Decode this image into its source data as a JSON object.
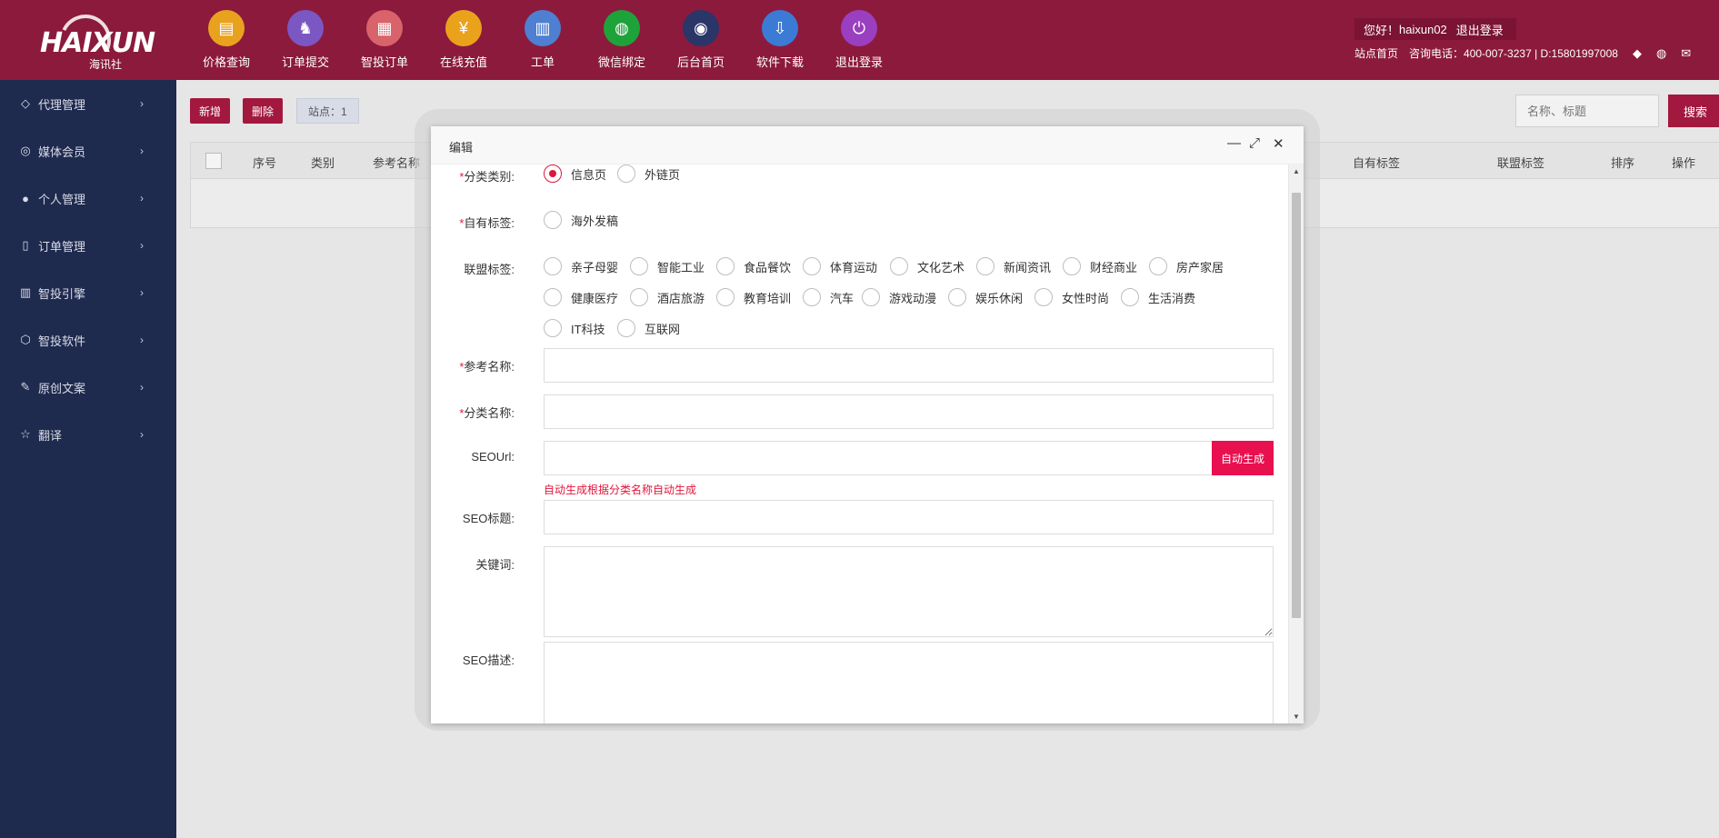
{
  "header": {
    "logo": {
      "brand": "HAIXUN",
      "sub": "海讯社"
    },
    "nav": [
      {
        "label": "价格查询",
        "icon": "price-icon",
        "glyph": "▤",
        "color": "#e9a21e"
      },
      {
        "label": "订单提交",
        "icon": "horse-icon",
        "glyph": "♞",
        "color": "#7b57c4"
      },
      {
        "label": "智投订单",
        "icon": "grid-icon",
        "glyph": "▦",
        "color": "#d9636a"
      },
      {
        "label": "在线充值",
        "icon": "coin-icon",
        "glyph": "¥",
        "color": "#eaa21c"
      },
      {
        "label": "工单",
        "icon": "clipboard-icon",
        "glyph": "▥",
        "color": "#4f7fd1"
      },
      {
        "label": "微信绑定",
        "icon": "wechat-icon",
        "glyph": "◍",
        "color": "#1ea33a"
      },
      {
        "label": "后台首页",
        "icon": "home-logo-icon",
        "glyph": "◉",
        "color": "#2a3568"
      },
      {
        "label": "软件下载",
        "icon": "download-icon",
        "glyph": "⇩",
        "color": "#3b7bd6"
      },
      {
        "label": "退出登录",
        "icon": "power-icon",
        "glyph": "⏻",
        "color": "#9a3fc0"
      }
    ],
    "greeting": "您好！",
    "username": "haixun02",
    "logout": "退出登录",
    "site_home": "站点首页",
    "hotline": "咨询电话：400-007-3237 | D:15801997008"
  },
  "sidebar": {
    "items": [
      {
        "label": "代理管理",
        "icon": "diamond-icon",
        "glyph": "◇"
      },
      {
        "label": "媒体会员",
        "icon": "globe-icon",
        "glyph": "◎"
      },
      {
        "label": "个人管理",
        "icon": "user-icon",
        "glyph": "●"
      },
      {
        "label": "订单管理",
        "icon": "document-icon",
        "glyph": "▯"
      },
      {
        "label": "智投引擎",
        "icon": "bars-icon",
        "glyph": "▥"
      },
      {
        "label": "智投软件",
        "icon": "cube-icon",
        "glyph": "⬡"
      },
      {
        "label": "原创文案",
        "icon": "edit-icon",
        "glyph": "✎"
      },
      {
        "label": "翻译",
        "icon": "star-icon",
        "glyph": "☆"
      }
    ]
  },
  "main": {
    "add_label": "新增",
    "delete_label": "删除",
    "site_chip": "站点：1",
    "search_placeholder": "名称、标题",
    "search_label": "搜索",
    "columns": [
      "序号",
      "类别",
      "参考名称",
      "自有标签",
      "联盟标签",
      "排序",
      "操作"
    ]
  },
  "modal": {
    "title": "编辑",
    "category_type": {
      "label": "分类类别:",
      "options": [
        "信息页",
        "外链页"
      ],
      "selected": "信息页"
    },
    "own_tags": {
      "label": "自有标签:",
      "options": [
        "海外发稿"
      ]
    },
    "alliance_tags": {
      "label": "联盟标签:",
      "options": [
        "亲子母婴",
        "智能工业",
        "食品餐饮",
        "体育运动",
        "文化艺术",
        "新闻资讯",
        "财经商业",
        "房产家居",
        "健康医疗",
        "酒店旅游",
        "教育培训",
        "汽车",
        "游戏动漫",
        "娱乐休闲",
        "女性时尚",
        "生活消费",
        "IT科技",
        "互联网"
      ]
    },
    "ref_name": {
      "label": "参考名称:",
      "value": ""
    },
    "cat_name": {
      "label": "分类名称:",
      "value": ""
    },
    "seo_url": {
      "label": "SEOUrl:",
      "value": "",
      "button": "自动生成",
      "hint": "自动生成根据分类名称自动生成"
    },
    "seo_title": {
      "label": "SEO标题:",
      "value": ""
    },
    "keywords": {
      "label": "关键词:",
      "value": ""
    },
    "seo_desc": {
      "label": "SEO描述:",
      "value": ""
    }
  }
}
